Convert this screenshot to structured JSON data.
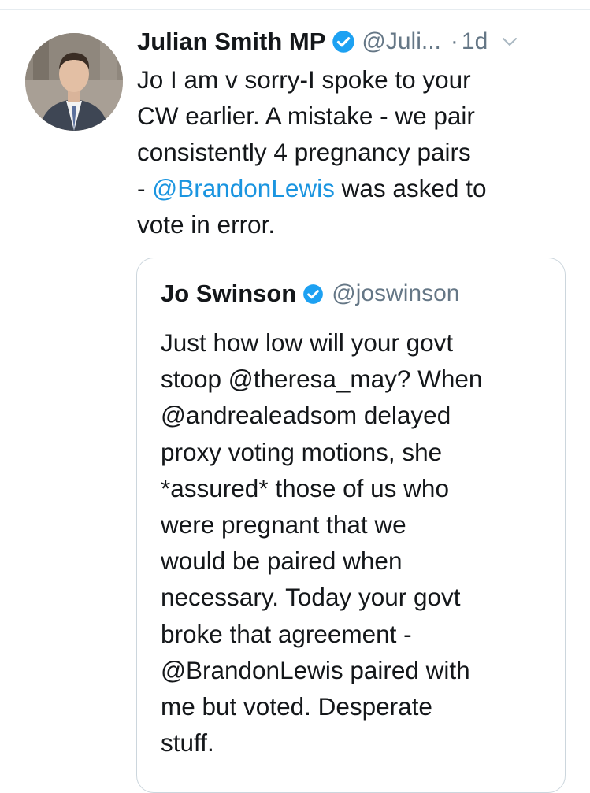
{
  "tweet": {
    "author_name": "Julian Smith MP",
    "handle": "@Juli...",
    "separator": "·",
    "time": "1d",
    "text_lines": [
      "Jo I am v sorry-I spoke to your",
      "CW earlier. A mistake - we pair",
      "consistently 4 pregnancy pairs"
    ],
    "line4_prefix": "- ",
    "line4_mention": "@BrandonLewis",
    "line4_suffix": " was asked to",
    "line5": "vote in error."
  },
  "quoted_tweet": {
    "author_name": "Jo Swinson",
    "handle": "@joswinson",
    "text_lines": [
      "Just how low will your govt",
      "stoop @theresa_may? When",
      "@andrealeadsom delayed",
      "proxy voting motions, she",
      "*assured* those of us who",
      "were pregnant that we",
      "would be paired when",
      "necessary. Today your govt",
      "broke that agreement -",
      "@BrandonLewis paired with",
      "me but voted. Desperate",
      "stuff."
    ]
  },
  "colors": {
    "text": "#14171a",
    "secondary": "#657786",
    "link": "#1b95e0",
    "verified": "#1da1f2",
    "border": "#ccd6dd"
  },
  "icons": {
    "verified": "verified-badge-icon",
    "more": "chevron-down-icon"
  }
}
